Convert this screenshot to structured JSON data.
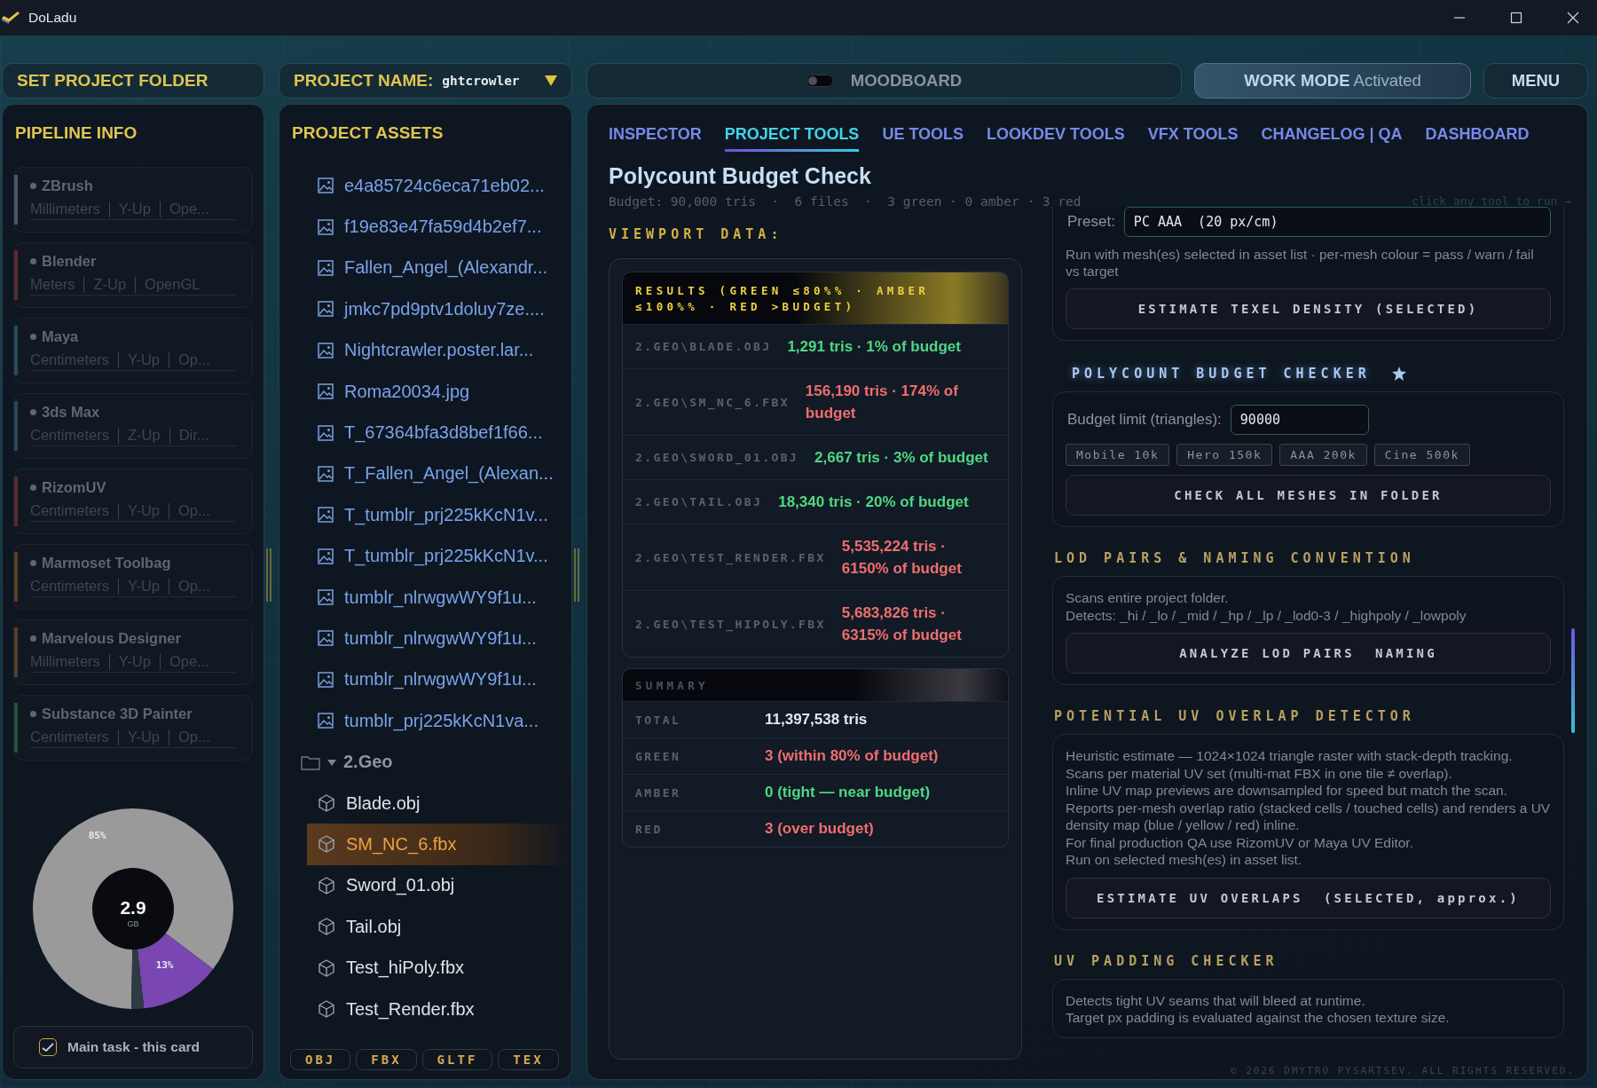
{
  "window": {
    "title": "DoLadu"
  },
  "top_bar": {
    "set_folder_button": "SET PROJECT FOLDER",
    "project_name": {
      "label": "PROJECT NAME:",
      "value": "ghtcrowler"
    },
    "moodboard": {
      "label": "MOODBOARD",
      "on": false
    },
    "work_mode": {
      "label": "WORK MODE",
      "status": "Activated"
    },
    "menu_button": "MENU"
  },
  "pipeline": {
    "title": "PIPELINE INFO",
    "apps": [
      {
        "name": "ZBrush",
        "units": "Millimeters",
        "axis": "Y-Up",
        "api": "Ope...",
        "color": "#4a5664"
      },
      {
        "name": "Blender",
        "units": "Meters",
        "axis": "Z-Up",
        "api": "OpenGL",
        "color": "#5a2e2e"
      },
      {
        "name": "Maya",
        "units": "Centimeters",
        "axis": "Y-Up",
        "api": "Op...",
        "color": "#234d57"
      },
      {
        "name": "3ds Max",
        "units": "Centimeters",
        "axis": "Z-Up",
        "api": "Dir...",
        "color": "#2c4656"
      },
      {
        "name": "RizomUV",
        "units": "Centimeters",
        "axis": "Y-Up",
        "api": "Op...",
        "color": "#5a2a30"
      },
      {
        "name": "Marmoset Toolbag",
        "units": "Centimeters",
        "axis": "Y-Up",
        "api": "Op...",
        "color": "#5a3e26"
      },
      {
        "name": "Marvelous Designer",
        "units": "Millimeters",
        "axis": "Y-Up",
        "api": "Ope...",
        "color": "#54402a"
      },
      {
        "name": "Substance 3D Painter",
        "units": "Centimeters",
        "axis": "Y-Up",
        "api": "Op...",
        "color": "#24503a"
      }
    ],
    "storage": {
      "chart_data": {
        "type": "donut",
        "values": [
          85,
          13,
          2
        ],
        "colors": [
          "#9a9a9a",
          "#7a46b2",
          "#2e3a44"
        ],
        "value_labels": [
          "85%",
          "13%",
          null
        ]
      },
      "center_value": "2.9",
      "center_unit": "GB"
    },
    "main_task": {
      "label": "Main task - this card",
      "checked": true
    }
  },
  "assets": {
    "title": "PROJECT ASSETS",
    "items": [
      {
        "kind": "image",
        "name": "e4a85724c6eca71eb02...",
        "selected": false
      },
      {
        "kind": "image",
        "name": "f19e83e47fa59d4b2ef7...",
        "selected": false
      },
      {
        "kind": "image",
        "name": "Fallen_Angel_(Alexandr...",
        "selected": false
      },
      {
        "kind": "image",
        "name": "jmkc7pd9ptv1doluy7ze....",
        "selected": false
      },
      {
        "kind": "image",
        "name": "Nightcrawler.poster.lar...",
        "selected": false
      },
      {
        "kind": "image",
        "name": "Roma20034.jpg",
        "selected": false
      },
      {
        "kind": "image",
        "name": "T_67364bfa3d8bef1f66...",
        "selected": false
      },
      {
        "kind": "image",
        "name": "T_Fallen_Angel_(Alexan...",
        "selected": false
      },
      {
        "kind": "image",
        "name": "T_tumblr_prj225kKcN1v...",
        "selected": false
      },
      {
        "kind": "image",
        "name": "T_tumblr_prj225kKcN1v...",
        "selected": false
      },
      {
        "kind": "image",
        "name": "tumblr_nlrwgwWY9f1u...",
        "selected": false
      },
      {
        "kind": "image",
        "name": "tumblr_nlrwgwWY9f1u...",
        "selected": false
      },
      {
        "kind": "image",
        "name": "tumblr_nlrwgwWY9f1u...",
        "selected": false
      },
      {
        "kind": "image",
        "name": "tumblr_prj225kKcN1va...",
        "selected": false
      },
      {
        "kind": "folder",
        "name": "2.Geo",
        "expanded": true,
        "selected": false,
        "children": [
          {
            "kind": "mesh",
            "name": "Blade.obj",
            "selected": false
          },
          {
            "kind": "mesh",
            "name": "SM_NC_6.fbx",
            "selected": true
          },
          {
            "kind": "mesh",
            "name": "Sword_01.obj",
            "selected": false
          },
          {
            "kind": "mesh",
            "name": "Tail.obj",
            "selected": false
          },
          {
            "kind": "mesh",
            "name": "Test_hiPoly.fbx",
            "selected": false
          },
          {
            "kind": "mesh",
            "name": "Test_Render.fbx",
            "selected": false
          }
        ]
      }
    ],
    "filters": [
      "OBJ",
      "FBX",
      "GLTF",
      "TEX"
    ]
  },
  "tabs": [
    {
      "label": "INSPECTOR",
      "selected": false
    },
    {
      "label": "PROJECT TOOLS",
      "selected": true
    },
    {
      "label": "UE TOOLS",
      "selected": false
    },
    {
      "label": "LOOKDEV TOOLS",
      "selected": false
    },
    {
      "label": "VFX TOOLS",
      "selected": false
    },
    {
      "label": "CHANGELOG | QA",
      "selected": false
    },
    {
      "label": "DASHBOARD",
      "selected": false
    }
  ],
  "tool": {
    "title": "Polycount Budget Check",
    "subtitle": "Budget: 90,000 tris  ·  6 files  ·  3 green · 0 amber · 3 red",
    "hint": "click any tool to run →",
    "viewport_label": "VIEWPORT DATA:",
    "results": {
      "header": "RESULTS (GREEN ≤80%% · AMBER ≤100%% · RED >BUDGET)",
      "rows": [
        {
          "path": "2.GEO\\BLADE.OBJ",
          "result": "1,291 tris · 1% of budget",
          "color": "#4ed882"
        },
        {
          "path": "2.GEO\\SM_NC_6.FBX",
          "result": "156,190 tris · 174% of budget",
          "color": "#f06e6e"
        },
        {
          "path": "2.GEO\\SWORD_01.OBJ",
          "result": "2,667 tris · 3% of budget",
          "color": "#4ed882"
        },
        {
          "path": "2.GEO\\TAIL.OBJ",
          "result": "18,340 tris · 20% of budget",
          "color": "#4ed882"
        },
        {
          "path": "2.GEO\\TEST_RENDER.FBX",
          "result": "5,535,224 tris · 6150% of budget",
          "color": "#f06e6e"
        },
        {
          "path": "2.GEO\\TEST_HIPOLY.FBX",
          "result": "5,683,826 tris · 6315% of budget",
          "color": "#f06e6e"
        }
      ]
    },
    "summary": {
      "header": "SUMMARY",
      "rows": [
        {
          "label": "TOTAL",
          "value": "11,397,538 tris",
          "color": "#e4e8ee"
        },
        {
          "label": "GREEN",
          "value": "3 (within 80% of budget)",
          "color": "#f06e6e"
        },
        {
          "label": "AMBER",
          "value": "0 (tight — near budget)",
          "color": "#4ed882"
        },
        {
          "label": "RED",
          "value": "3 (over budget)",
          "color": "#f06e6e"
        }
      ]
    }
  },
  "tool_panel": {
    "sections": [
      {
        "items": [
          {
            "kind": "field",
            "label": "Preset:",
            "value": "PC AAA  (20 px/cm)",
            "wide": true
          },
          {
            "kind": "note",
            "text": "Run with mesh(es) selected in asset list  ·  per-mesh colour = pass / warn / fail vs target"
          },
          {
            "kind": "button",
            "label": "ESTIMATE TEXEL DENSITY (SELECTED)"
          }
        ]
      },
      {
        "title": "POLYCOUNT BUDGET CHECKER",
        "starred": true,
        "items": [
          {
            "kind": "field",
            "label": "Budget limit (triangles):",
            "value": "90000",
            "wide": false
          },
          {
            "kind": "chips",
            "chips": [
              "Mobile 10k",
              "Hero 150k",
              "AAA 200k",
              "Cine 500k"
            ]
          },
          {
            "kind": "button",
            "label": "CHECK ALL MESHES IN FOLDER"
          }
        ]
      },
      {
        "title": "LOD PAIRS & NAMING CONVENTION",
        "starred": false,
        "items": [
          {
            "kind": "lines",
            "lines": [
              "Scans entire project folder.",
              "Detects: _hi / _lo / _mid / _hp / _lp / _lod0-3 / _highpoly / _lowpoly"
            ]
          },
          {
            "kind": "button",
            "label": "ANALYZE LOD PAIRS  NAMING"
          }
        ]
      },
      {
        "title": "POTENTIAL UV OVERLAP DETECTOR",
        "starred": false,
        "items": [
          {
            "kind": "lines",
            "lines": [
              "Heuristic estimate  —  1024×1024 triangle raster with stack-depth tracking.",
              "Scans per material UV set (multi-mat FBX in one tile ≠ overlap).",
              "Inline UV map previews are downsampled for speed but match the scan.",
              "Reports per-mesh overlap ratio (stacked cells / touched cells) and renders a UV density map (blue / yellow / red) inline.",
              "For final production QA use RizomUV or Maya UV Editor.",
              "Run on selected mesh(es) in asset list."
            ]
          },
          {
            "kind": "button",
            "label": "ESTIMATE UV OVERLAPS  (SELECTED, approx.)"
          }
        ]
      },
      {
        "title": "UV PADDING CHECKER",
        "starred": false,
        "items": [
          {
            "kind": "lines",
            "lines": [
              "Detects tight UV seams that will bleed at runtime.",
              "Target px padding is evaluated against the chosen texture size."
            ]
          }
        ]
      }
    ]
  },
  "footer": "© 2026 DMYTRO PYSARTSEV. ALL RIGHTS RESERVED."
}
